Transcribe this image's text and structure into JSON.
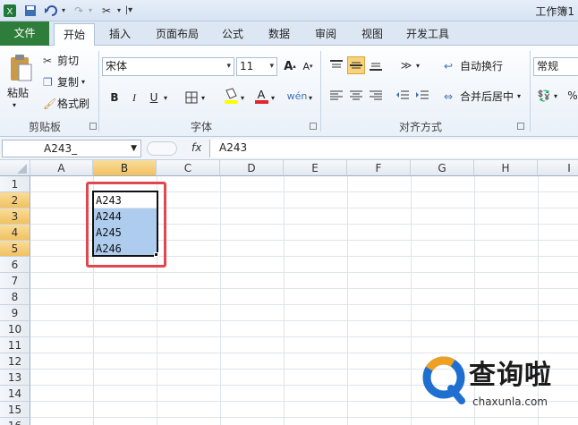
{
  "titlebar": {
    "title": "工作簿1"
  },
  "tabs": [
    {
      "label": "文件"
    },
    {
      "label": "开始"
    },
    {
      "label": "插入"
    },
    {
      "label": "页面布局"
    },
    {
      "label": "公式"
    },
    {
      "label": "数据"
    },
    {
      "label": "审阅"
    },
    {
      "label": "视图"
    },
    {
      "label": "开发工具"
    }
  ],
  "ribbon": {
    "clipboard": {
      "paste": "粘贴",
      "cut": "剪切",
      "copy": "复制",
      "format_painter": "格式刷",
      "group": "剪贴板"
    },
    "font": {
      "font_name": "宋体",
      "font_size": "11",
      "bold": "B",
      "italic": "I",
      "underline": "U",
      "group": "字体"
    },
    "alignment": {
      "wrap": "自动换行",
      "merge": "合并后居中",
      "group": "对齐方式"
    },
    "number": {
      "format": "常规",
      "percent": "%"
    }
  },
  "formula_bar": {
    "name_box": "A243_",
    "fx": "fx",
    "formula": "A243"
  },
  "columns": [
    "A",
    "B",
    "C",
    "D",
    "E",
    "F",
    "G",
    "H",
    "I"
  ],
  "rows": [
    "1",
    "2",
    "3",
    "4",
    "5",
    "6",
    "7",
    "8",
    "9",
    "10",
    "11",
    "12",
    "13",
    "14",
    "15",
    "16"
  ],
  "cells": {
    "B2": "A243",
    "B3": "A244",
    "B4": "A245",
    "B5": "A246"
  },
  "watermark": {
    "brand": "查询啦",
    "domain": "chaxunla.com"
  },
  "colors": {
    "file_tab": "#2f7d3a",
    "selection": "#aecdee",
    "highlight_box": "#e0484e",
    "header_selected": "#f1c15f"
  }
}
